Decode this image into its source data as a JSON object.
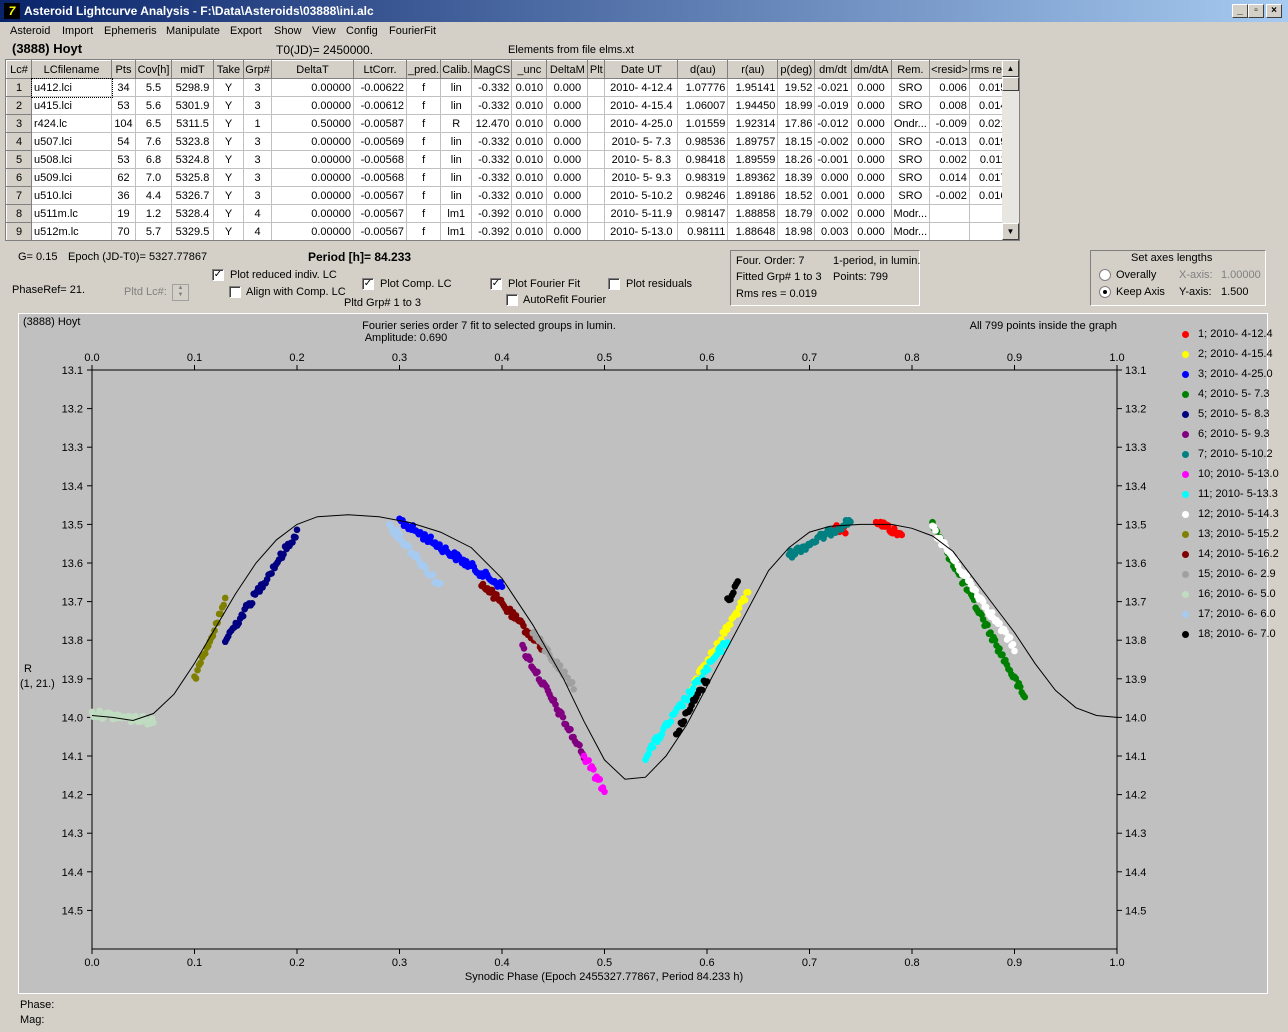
{
  "window": {
    "title": "Asteroid Lightcurve Analysis - F:\\Data\\Asteroids\\03888\\ini.alc",
    "min_label": "_",
    "max_label": "▫",
    "close_label": "×"
  },
  "menu": [
    "Asteroid",
    "Import",
    "Ephemeris",
    "Manipulate",
    "Export",
    "Show",
    "View",
    "Config",
    "FourierFit"
  ],
  "header": {
    "asteroid": "(3888) Hoyt",
    "t0": "T0(JD)= 2450000.",
    "elements": "Elements from file elms.xt"
  },
  "table": {
    "columns": [
      "Lc#",
      "LCfilename",
      "Pts",
      "Cov[h]",
      "midT",
      "Take",
      "Grp#",
      "DeltaT",
      "LtCorr.",
      "_pred.",
      "Calib.",
      "MagCS",
      "_unc",
      "DeltaM",
      "Plt",
      "Date UT",
      "d(au)",
      "r(au)",
      "p(deg)",
      "dm/dt",
      "dm/dtA",
      "Rem.",
      "<resid>",
      "rms res"
    ],
    "rows": [
      [
        "1",
        "u412.lci",
        "34",
        "5.5",
        "5298.9",
        "Y",
        "3",
        "0.00000",
        "-0.00622",
        "f",
        "lin",
        "-0.332",
        "0.010",
        "0.000",
        "",
        "2010- 4-12.4",
        "1.07776",
        "1.95141",
        "19.52",
        "-0.021",
        "0.000",
        "SRO",
        "0.006",
        "0.015"
      ],
      [
        "2",
        "u415.lci",
        "53",
        "5.6",
        "5301.9",
        "Y",
        "3",
        "0.00000",
        "-0.00612",
        "f",
        "lin",
        "-0.332",
        "0.010",
        "0.000",
        "",
        "2010- 4-15.4",
        "1.06007",
        "1.94450",
        "18.99",
        "-0.019",
        "0.000",
        "SRO",
        "0.008",
        "0.014"
      ],
      [
        "3",
        "r424.lc",
        "104",
        "6.5",
        "5311.5",
        "Y",
        "1",
        "0.50000",
        "-0.00587",
        "f",
        "R",
        "12.470",
        "0.010",
        "0.000",
        "",
        "2010- 4-25.0",
        "1.01559",
        "1.92314",
        "17.86",
        "-0.012",
        "0.000",
        "Ondr...",
        "-0.009",
        "0.021"
      ],
      [
        "4",
        "u507.lci",
        "54",
        "7.6",
        "5323.8",
        "Y",
        "3",
        "0.00000",
        "-0.00569",
        "f",
        "lin",
        "-0.332",
        "0.010",
        "0.000",
        "",
        "2010- 5- 7.3",
        "0.98536",
        "1.89757",
        "18.15",
        "-0.002",
        "0.000",
        "SRO",
        "-0.013",
        "0.019"
      ],
      [
        "5",
        "u508.lci",
        "53",
        "6.8",
        "5324.8",
        "Y",
        "3",
        "0.00000",
        "-0.00568",
        "f",
        "lin",
        "-0.332",
        "0.010",
        "0.000",
        "",
        "2010- 5- 8.3",
        "0.98418",
        "1.89559",
        "18.26",
        "-0.001",
        "0.000",
        "SRO",
        "0.002",
        "0.011"
      ],
      [
        "6",
        "u509.lci",
        "62",
        "7.0",
        "5325.8",
        "Y",
        "3",
        "0.00000",
        "-0.00568",
        "f",
        "lin",
        "-0.332",
        "0.010",
        "0.000",
        "",
        "2010- 5- 9.3",
        "0.98319",
        "1.89362",
        "18.39",
        "0.000",
        "0.000",
        "SRO",
        "0.014",
        "0.017"
      ],
      [
        "7",
        "u510.lci",
        "36",
        "4.4",
        "5326.7",
        "Y",
        "3",
        "0.00000",
        "-0.00567",
        "f",
        "lin",
        "-0.332",
        "0.010",
        "0.000",
        "",
        "2010- 5-10.2",
        "0.98246",
        "1.89186",
        "18.52",
        "0.001",
        "0.000",
        "SRO",
        "-0.002",
        "0.016"
      ],
      [
        "8",
        "u511m.lc",
        "19",
        "1.2",
        "5328.4",
        "Y",
        "4",
        "0.00000",
        "-0.00567",
        "f",
        "lm1",
        "-0.392",
        "0.010",
        "0.000",
        "",
        "2010- 5-11.9",
        "0.98147",
        "1.88858",
        "18.79",
        "0.002",
        "0.000",
        "Modr...",
        "",
        ""
      ],
      [
        "9",
        "u512m.lc",
        "70",
        "5.7",
        "5329.5",
        "Y",
        "4",
        "0.00000",
        "-0.00567",
        "f",
        "lm1",
        "-0.392",
        "0.010",
        "0.000",
        "",
        "2010- 5-13.0",
        "0.98111",
        "1.88648",
        "18.98",
        "0.003",
        "0.000",
        "Modr...",
        "",
        ""
      ]
    ]
  },
  "controls": {
    "g": "G= 0.15",
    "epoch": "Epoch (JD-T0)= 5327.77867",
    "period": "Period [h]= 84.233",
    "phaseref": "PhaseRef= 21.",
    "pltd_lc": "Pltd Lc#:",
    "plot_reduced": "Plot reduced indiv. LC",
    "align": "Align with Comp. LC",
    "plot_comp": "Plot Comp. LC",
    "pltd_grp": "Pltd Grp#  1   to    3",
    "plot_fourier": "Plot Fourier Fit",
    "autorefit": "AutoRefit Fourier",
    "plot_residuals": "Plot residuals",
    "check": "✓",
    "fourier_info": {
      "order": "Four. Order:  7",
      "mode": "1-period, in lumin.",
      "fitted": "Fitted Grp# 1 to 3",
      "points": "Points: 799",
      "rms": "Rms res      = 0.019"
    },
    "axes": {
      "title": "Set axes lengths",
      "overally": "Overally",
      "keep": "Keep Axis",
      "xaxis_label": "X-axis:",
      "xaxis_value": "1.00000",
      "yaxis_label": "Y-axis:",
      "yaxis_value": "1.500"
    }
  },
  "chart_data": {
    "type": "scatter",
    "object": "(3888) Hoyt",
    "title": "Fourier series order 7 fit to selected groups in lumin.",
    "subtitle": "Amplitude: 0.690",
    "note": "All 799 points inside the graph",
    "xlabel": "Synodic Phase (Epoch 2455327.77867, Period 84.233 h)",
    "ylabel": "R",
    "ylabel2": "(1, 21.)",
    "xlim": [
      0,
      1
    ],
    "ylim": [
      13.1,
      14.6
    ],
    "y_inverted": true,
    "xticks": [
      "0.0",
      "0.1",
      "0.2",
      "0.3",
      "0.4",
      "0.5",
      "0.6",
      "0.7",
      "0.8",
      "0.9",
      "1.0"
    ],
    "yticks": [
      "13.1",
      "13.2",
      "13.3",
      "13.4",
      "13.5",
      "13.6",
      "13.7",
      "13.8",
      "13.9",
      "14.0",
      "14.1",
      "14.2",
      "14.3",
      "14.4",
      "14.5"
    ],
    "fit_curve": [
      [
        0,
        13.995
      ],
      [
        0.02,
        14.0
      ],
      [
        0.04,
        14.008
      ],
      [
        0.06,
        13.99
      ],
      [
        0.08,
        13.94
      ],
      [
        0.1,
        13.86
      ],
      [
        0.12,
        13.77
      ],
      [
        0.14,
        13.68
      ],
      [
        0.16,
        13.6
      ],
      [
        0.18,
        13.54
      ],
      [
        0.2,
        13.5
      ],
      [
        0.22,
        13.48
      ],
      [
        0.25,
        13.475
      ],
      [
        0.28,
        13.48
      ],
      [
        0.31,
        13.495
      ],
      [
        0.34,
        13.52
      ],
      [
        0.37,
        13.56
      ],
      [
        0.4,
        13.64
      ],
      [
        0.43,
        13.76
      ],
      [
        0.46,
        13.9
      ],
      [
        0.48,
        14.01
      ],
      [
        0.5,
        14.11
      ],
      [
        0.52,
        14.16
      ],
      [
        0.54,
        14.155
      ],
      [
        0.56,
        14.1
      ],
      [
        0.58,
        14.02
      ],
      [
        0.6,
        13.92
      ],
      [
        0.62,
        13.82
      ],
      [
        0.64,
        13.72
      ],
      [
        0.66,
        13.62
      ],
      [
        0.68,
        13.56
      ],
      [
        0.7,
        13.52
      ],
      [
        0.72,
        13.505
      ],
      [
        0.75,
        13.5
      ],
      [
        0.78,
        13.5
      ],
      [
        0.8,
        13.51
      ],
      [
        0.82,
        13.53
      ],
      [
        0.84,
        13.57
      ],
      [
        0.86,
        13.64
      ],
      [
        0.88,
        13.71
      ],
      [
        0.9,
        13.78
      ],
      [
        0.92,
        13.86
      ],
      [
        0.94,
        13.93
      ],
      [
        0.96,
        13.975
      ],
      [
        0.98,
        13.995
      ],
      [
        1.0,
        14.0
      ]
    ],
    "series": [
      {
        "name": "1; 2010- 4-12.4",
        "color": "#ff0000",
        "ranges": [
          [
            0.725,
            0.735,
            13.505,
            13.515
          ],
          [
            0.765,
            0.79,
            13.49,
            13.53
          ]
        ]
      },
      {
        "name": "2; 2010- 4-15.4",
        "color": "#ffff00",
        "ranges": [
          [
            0.585,
            0.64,
            13.92,
            13.68
          ]
        ]
      },
      {
        "name": "3; 2010- 4-25.0",
        "color": "#0000ff",
        "ranges": [
          [
            0.3,
            0.4,
            13.49,
            13.66
          ]
        ]
      },
      {
        "name": "4; 2010- 5- 7.3",
        "color": "#008000",
        "ranges": [
          [
            0.82,
            0.91,
            13.5,
            13.95
          ]
        ]
      },
      {
        "name": "5; 2010- 5- 8.3",
        "color": "#000080",
        "ranges": [
          [
            0.13,
            0.2,
            13.8,
            13.52
          ]
        ]
      },
      {
        "name": "6; 2010- 5- 9.3",
        "color": "#800080",
        "ranges": [
          [
            0.42,
            0.48,
            13.82,
            14.1
          ]
        ]
      },
      {
        "name": "7; 2010- 5-10.2",
        "color": "#008080",
        "ranges": [
          [
            0.68,
            0.74,
            13.58,
            13.49
          ]
        ]
      },
      {
        "name": "10; 2010- 5-13.0",
        "color": "#ff00ff",
        "ranges": [
          [
            0.48,
            0.5,
            14.1,
            14.19
          ]
        ]
      },
      {
        "name": "11; 2010- 5-13.3",
        "color": "#00ffff",
        "ranges": [
          [
            0.54,
            0.62,
            14.1,
            13.8
          ]
        ]
      },
      {
        "name": "12; 2010- 5-14.3",
        "color": "#ffffff",
        "ranges": [
          [
            0.82,
            0.9,
            13.51,
            13.82
          ]
        ]
      },
      {
        "name": "13; 2010- 5-15.2",
        "color": "#808000",
        "ranges": [
          [
            0.1,
            0.13,
            13.9,
            13.7
          ]
        ]
      },
      {
        "name": "14; 2010- 5-16.2",
        "color": "#800000",
        "ranges": [
          [
            0.38,
            0.44,
            13.65,
            13.82
          ]
        ]
      },
      {
        "name": "15; 2010- 6- 2.9",
        "color": "#a0a0a0",
        "ranges": [
          [
            0.43,
            0.47,
            13.78,
            13.92
          ]
        ]
      },
      {
        "name": "16; 2010- 6- 5.0",
        "color": "#c0dcc0",
        "ranges": [
          [
            0.0,
            0.06,
            13.99,
            14.01
          ]
        ]
      },
      {
        "name": "17; 2010- 6- 6.0",
        "color": "#a6caf0",
        "ranges": [
          [
            0.29,
            0.34,
            13.5,
            13.66
          ]
        ]
      },
      {
        "name": "18; 2010- 6- 7.0",
        "color": "#000000",
        "ranges": [
          [
            0.57,
            0.6,
            14.04,
            13.9
          ],
          [
            0.62,
            0.63,
            13.7,
            13.65
          ]
        ]
      }
    ]
  },
  "status": {
    "phase": "Phase:",
    "mag": "Mag:"
  }
}
